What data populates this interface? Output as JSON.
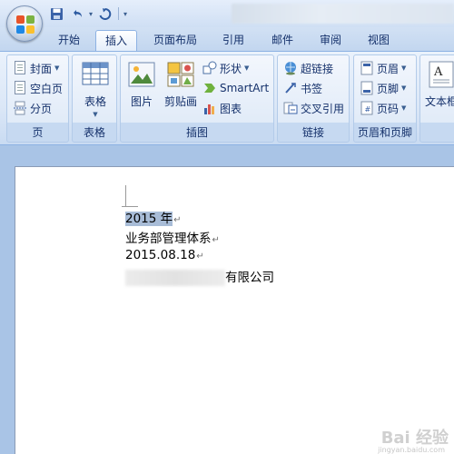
{
  "titlebar": {
    "office_button_label": "Office",
    "qat": {
      "undo_dropdown": "▾",
      "customize": "▾"
    }
  },
  "tabs": [
    {
      "id": "home",
      "label": "开始",
      "active": false
    },
    {
      "id": "insert",
      "label": "插入",
      "active": true
    },
    {
      "id": "page_layout",
      "label": "页面布局",
      "active": false
    },
    {
      "id": "references",
      "label": "引用",
      "active": false
    },
    {
      "id": "mailings",
      "label": "邮件",
      "active": false
    },
    {
      "id": "review",
      "label": "审阅",
      "active": false
    },
    {
      "id": "view",
      "label": "视图",
      "active": false
    }
  ],
  "ribbon": {
    "pages": {
      "label": "页",
      "cover": "封面",
      "blank": "空白页",
      "break": "分页"
    },
    "tables": {
      "label": "表格",
      "table": "表格"
    },
    "illustrations": {
      "label": "插图",
      "picture": "图片",
      "clipart": "剪贴画",
      "shapes": "形状",
      "smartart": "SmartArt",
      "chart": "图表"
    },
    "links": {
      "label": "链接",
      "hyperlink": "超链接",
      "bookmark": "书签",
      "crossref": "交叉引用"
    },
    "header_footer": {
      "label": "页眉和页脚",
      "header": "页眉",
      "footer": "页脚",
      "page_number": "页码"
    },
    "text": {
      "textbox": "文本框"
    }
  },
  "document": {
    "lines": [
      {
        "text": "2015 年",
        "selected": true
      },
      {
        "text": "业务部管理体系",
        "selected": false
      },
      {
        "text": "2015.08.18",
        "selected": false
      },
      {
        "text": "有限公司",
        "selected": false,
        "redacted_prefix": true
      }
    ],
    "paragraph_mark": "↵"
  },
  "watermark": {
    "brand": "Bai 经验",
    "url": "jingyan.baidu.com"
  },
  "colors": {
    "ribbon_accent": "#8db2e3",
    "selection": "#a8bcd7",
    "workspace": "#a9c4e6"
  }
}
